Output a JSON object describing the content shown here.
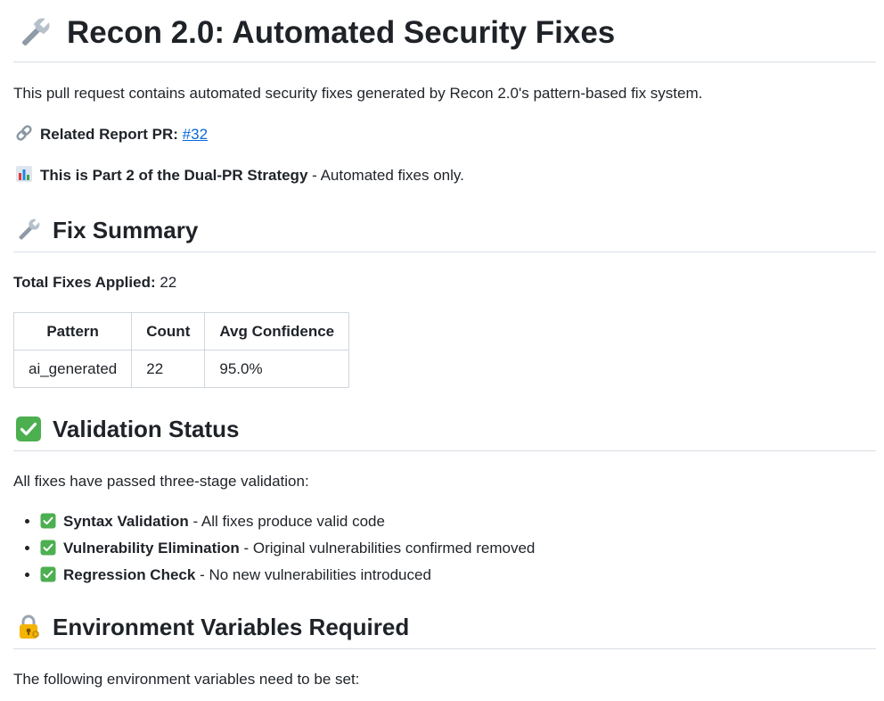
{
  "title": "Recon 2.0: Automated Security Fixes",
  "intro": "This pull request contains automated security fixes generated by Recon 2.0's pattern-based fix system.",
  "related": {
    "label": "Related Report PR:",
    "link_text": "#32"
  },
  "strategy": {
    "bold": "This is Part 2 of the Dual-PR Strategy",
    "rest": " - Automated fixes only."
  },
  "fix_summary": {
    "heading": "Fix Summary",
    "total_label": "Total Fixes Applied:",
    "total_value": " 22",
    "table": {
      "headers": [
        "Pattern",
        "Count",
        "Avg Confidence"
      ],
      "rows": [
        [
          "ai_generated",
          "22",
          "95.0%"
        ]
      ]
    }
  },
  "validation": {
    "heading": "Validation Status",
    "intro": "All fixes have passed three-stage validation:",
    "items": [
      {
        "bold": "Syntax Validation",
        "rest": " - All fixes produce valid code"
      },
      {
        "bold": "Vulnerability Elimination",
        "rest": " - Original vulnerabilities confirmed removed"
      },
      {
        "bold": "Regression Check",
        "rest": " - No new vulnerabilities introduced"
      }
    ]
  },
  "environment": {
    "heading": "Environment Variables Required",
    "intro": "The following environment variables need to be set:"
  },
  "icons": {
    "title": "wrench-icon",
    "related": "link-icon",
    "strategy": "bar-chart-icon",
    "fix_summary": "wrench-icon",
    "validation": "check-mark-button-icon",
    "environment": "locked-with-key-icon"
  },
  "colors": {
    "link": "#0969da",
    "check_green": "#4caf50",
    "divider": "#d8dee4"
  }
}
